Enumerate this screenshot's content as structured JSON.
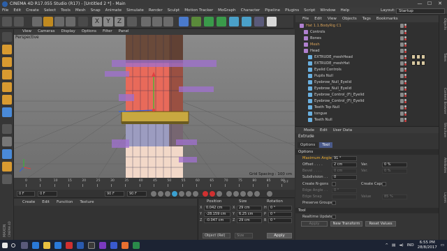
{
  "window": {
    "title": "CINEMA 4D R17.055 Studio (R17) - [Untitled 2 *] - Main",
    "controls": [
      "—",
      "☐",
      "✕"
    ]
  },
  "menubar": {
    "items": [
      "File",
      "Edit",
      "Create",
      "Select",
      "Tools",
      "Mesh",
      "Snap",
      "Animate",
      "Simulate",
      "Render",
      "Sculpt",
      "Motion Tracker",
      "MoGraph",
      "Character",
      "Pipeline",
      "Plugins",
      "Script",
      "Window",
      "Help"
    ],
    "layout_label": "Layout:",
    "layout_value": "Startup"
  },
  "viewport": {
    "menu": [
      "View",
      "Cameras",
      "Display",
      "Options",
      "Filter",
      "Panel"
    ],
    "label": "Perspective",
    "grid_spacing": "Grid Spacing : 100 cm"
  },
  "timeline": {
    "ticks": [
      "0",
      "5",
      "10",
      "15",
      "20",
      "25",
      "30",
      "35",
      "40",
      "45",
      "50",
      "55",
      "60",
      "65",
      "70",
      "75",
      "80",
      "85",
      "90"
    ],
    "end_marker": "0 F",
    "current_frame": "0 F",
    "start_field": "0 F",
    "end_field": "90 F",
    "max_field": "90 F"
  },
  "material_manager": {
    "menu": [
      "Create",
      "Edit",
      "Function",
      "Texture"
    ]
  },
  "coordinates": {
    "headers": [
      "Position",
      "Size",
      "Rotation"
    ],
    "rows": [
      {
        "axis": "X",
        "position": "0.042 cm",
        "size_axis": "X",
        "size": "29 cm",
        "rot_axis": "H",
        "rotation": "0 °"
      },
      {
        "axis": "Y",
        "position": "-28.159 cm",
        "size_axis": "Y",
        "size": "6.25 cm",
        "rot_axis": "P",
        "rotation": "0 °"
      },
      {
        "axis": "Z",
        "position": "-0.047 cm",
        "size_axis": "Z",
        "size": "29 cm",
        "rot_axis": "B",
        "rotation": "0 °"
      }
    ],
    "mode": "Object (Rel)",
    "size_mode": "Size",
    "apply": "Apply"
  },
  "object_manager": {
    "menu": [
      "File",
      "Edit",
      "View",
      "Objects",
      "Tags",
      "Bookmarks"
    ],
    "rows": [
      {
        "name": "Hat 1.1.BodyRig C1",
        "indent": 0,
        "color": "#d9a35a"
      },
      {
        "name": "Controls",
        "indent": 1,
        "color": "#cfcfcf"
      },
      {
        "name": "Bones",
        "indent": 1,
        "color": "#cfcfcf"
      },
      {
        "name": "Mesh",
        "indent": 1,
        "color": "#d9a35a"
      },
      {
        "name": "Head",
        "indent": 1,
        "color": "#cfcfcf"
      },
      {
        "name": "EXTRUDE_meshHead",
        "indent": 2,
        "color": "#cfcfcf"
      },
      {
        "name": "EXTRUDE_meshHat",
        "indent": 2,
        "color": "#cfcfcf"
      },
      {
        "name": "Eyelid Controls",
        "indent": 2,
        "color": "#cfcfcf"
      },
      {
        "name": "Pupils Null",
        "indent": 2,
        "color": "#cfcfcf"
      },
      {
        "name": "Eyebrow_Null_Eyelid",
        "indent": 2,
        "color": "#cfcfcf"
      },
      {
        "name": "Eyebrow_Null_Eyelid",
        "indent": 2,
        "color": "#cfcfcf"
      },
      {
        "name": "Eyebrow_Control_(F)_Eyelid",
        "indent": 2,
        "color": "#cfcfcf"
      },
      {
        "name": "Eyebrow_Control_(F)_Eyelid",
        "indent": 2,
        "color": "#cfcfcf"
      },
      {
        "name": "Teeth Top Null",
        "indent": 2,
        "color": "#cfcfcf"
      },
      {
        "name": "tongue",
        "indent": 2,
        "color": "#cfcfcf"
      },
      {
        "name": "Teeth Null",
        "indent": 2,
        "color": "#cfcfcf"
      }
    ]
  },
  "right_tabs": [
    "Objects",
    "Takes",
    "Content Browser",
    "Structure",
    "Attributes",
    "Layers"
  ],
  "attribute_manager": {
    "menu": [
      "Mode",
      "Edit",
      "User Data"
    ],
    "object": "Extrude",
    "tabs": [
      "Options",
      "Tool"
    ],
    "active_tab": "Tool",
    "section_options": "Options",
    "maximum_angle_label": "Maximum Angle",
    "maximum_angle": "91 °",
    "offset_label": "Offset . . . .",
    "offset": "2 cm",
    "var_label": "Var.",
    "var_value": "0 %",
    "bevel_label": "Bevel . . . .",
    "bevel": "0 cm",
    "bevel_var_value": "0 %",
    "subdivision_label": "Subdivision . .",
    "subdivision": "0",
    "create_ngons_label": "Create N-gons",
    "create_caps_label": "Create Caps",
    "edge_angle_label": "Edge Angle . .",
    "edge_angle": "0 °",
    "edge_snap_label": "Edge Snap",
    "edge_snap": "",
    "value_label": "Value",
    "value": "85 %",
    "preserve_groups_label": "Preserve Groups",
    "section_tool": "Tool",
    "realtime_update_label": "Realtime Update",
    "apply_label": "Apply",
    "new_transform_label": "New Transform",
    "reset_values_label": "Reset Values"
  },
  "taskbar": {
    "language": "IND",
    "time": "6:55 PM",
    "date": "28/8/2017"
  },
  "brand": "MAXON CINEMA 4D"
}
